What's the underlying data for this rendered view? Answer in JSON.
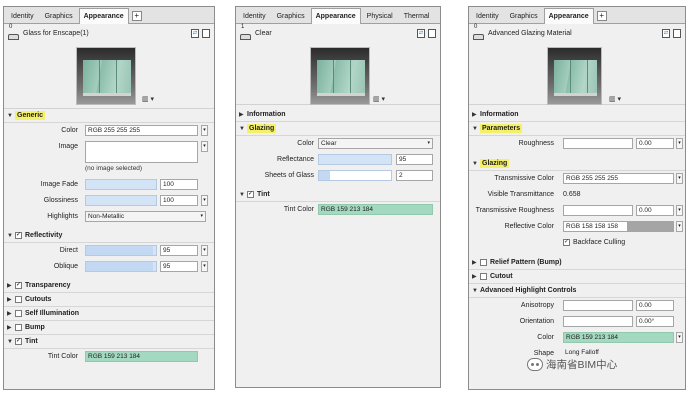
{
  "panel1": {
    "tabs": [
      "Identity",
      "Graphics",
      "Appearance"
    ],
    "active_tab": "Appearance",
    "header_count": "0",
    "title": "Glass for Enscape(1)",
    "sections": {
      "generic": "Generic",
      "reflectivity": "Reflectivity",
      "transparency": "Transparency",
      "cutouts": "Cutouts",
      "self_illumination": "Self Illumination",
      "bump": "Bump",
      "tint": "Tint"
    },
    "color_label": "Color",
    "color_value": "RGB 255 255 255",
    "image_label": "Image",
    "no_image": "(no image selected)",
    "image_fade_label": "Image Fade",
    "image_fade_value": "100",
    "glossiness_label": "Glossiness",
    "glossiness_value": "100",
    "highlights_label": "Highlights",
    "highlights_value": "Non-Metallic",
    "direct_label": "Direct",
    "direct_value": "95",
    "oblique_label": "Oblique",
    "oblique_value": "95",
    "tint_color_label": "Tint Color",
    "tint_color_value": "RGB 159 213 184"
  },
  "panel2": {
    "tabs": [
      "Identity",
      "Graphics",
      "Appearance",
      "Physical",
      "Thermal"
    ],
    "active_tab": "Appearance",
    "header_count": "1",
    "title": "Clear",
    "sections": {
      "information": "Information",
      "glazing": "Glazing",
      "tint": "Tint"
    },
    "color_label": "Color",
    "color_value": "Clear",
    "reflectance_label": "Reflectance",
    "reflectance_value": "95",
    "sheets_label": "Sheets of Glass",
    "sheets_value": "2",
    "tint_color_label": "Tint Color",
    "tint_color_value": "RGB 159 213 184"
  },
  "panel3": {
    "tabs": [
      "Identity",
      "Graphics",
      "Appearance"
    ],
    "active_tab": "Appearance",
    "header_count": "0",
    "title": "Advanced Glazing Material",
    "sections": {
      "information": "Information",
      "parameters": "Parameters",
      "glazing": "Glazing",
      "relief": "Relief Pattern (Bump)",
      "cutout": "Cutout",
      "advanced": "Advanced Highlight Controls"
    },
    "roughness_label": "Roughness",
    "roughness_value": "0.00",
    "trans_color_label": "Transmissive Color",
    "trans_color_value": "RGB 255 255 255",
    "visible_trans_label": "Visible Transmittance",
    "visible_trans_value": "0.658",
    "trans_rough_label": "Transmissive Roughness",
    "trans_rough_value": "0.00",
    "refl_color_label": "Reflective Color",
    "refl_color_value": "RGB 158 158 158",
    "backface_label": "Backface Culling",
    "anisotropy_label": "Anisotropy",
    "anisotropy_value": "0.00",
    "orientation_label": "Orientation",
    "orientation_value": "0.00°",
    "color_label": "Color",
    "color_value": "RGB 159 213 184",
    "shape_label": "Shape",
    "shape_value": "Long Falloff"
  },
  "watermark": "海南省BIM中心",
  "colors": {
    "tint": "#a3d9c0",
    "slider": "#d4e4f7",
    "highlight": "#f5f069",
    "reflective": "#a5a5a5"
  }
}
